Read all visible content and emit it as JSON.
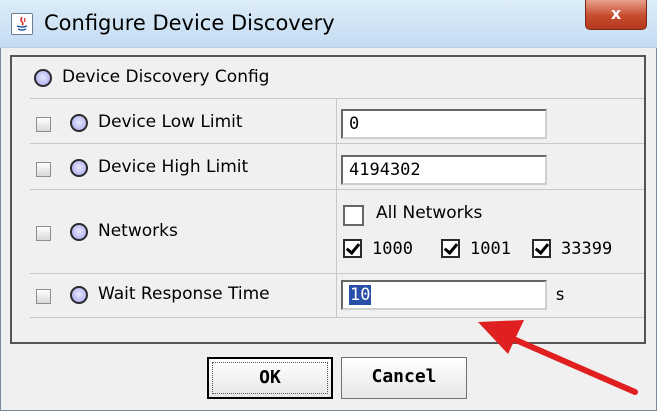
{
  "window": {
    "title": "Configure Device Discovery",
    "close_symbol": "x",
    "app_icon": "java-icon"
  },
  "config": {
    "heading": "Device Discovery Config",
    "rows": [
      {
        "label": "Device Low Limit",
        "value": "0"
      },
      {
        "label": "Device High Limit",
        "value": "4194302"
      },
      {
        "label": "Networks"
      },
      {
        "label": "Wait Response Time",
        "value": "10",
        "unit": "s"
      }
    ],
    "networks": {
      "all_label": "All Networks",
      "all_checked": false,
      "items": [
        {
          "label": "1000",
          "checked": true
        },
        {
          "label": "1001",
          "checked": true
        },
        {
          "label": "33399",
          "checked": true
        }
      ]
    }
  },
  "buttons": {
    "ok": "OK",
    "cancel": "Cancel"
  },
  "colors": {
    "titlebar": "#c4dcf2",
    "close_button": "#c74a2c",
    "selection": "#2a4fa8",
    "arrow": "#e02020"
  }
}
